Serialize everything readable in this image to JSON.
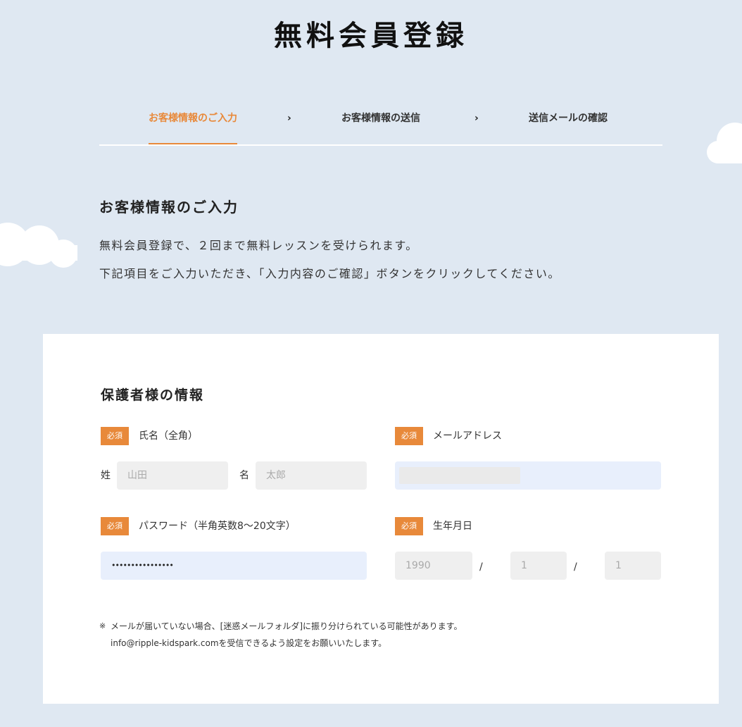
{
  "page_title": "無料会員登録",
  "steps": [
    {
      "label": "お客様情報のご入力",
      "active": true
    },
    {
      "label": "お客様情報の送信",
      "active": false
    },
    {
      "label": "送信メールの確認",
      "active": false
    }
  ],
  "chevron": "›",
  "section_heading": "お客様情報のご入力",
  "intro_lines": [
    "無料会員登録で、２回まで無料レッスンを受けられます。",
    "下記項目をご入力いただき、「入力内容のご確認」ボタンをクリックしてください。"
  ],
  "form": {
    "heading": "保護者様の情報",
    "required_badge": "必須",
    "name": {
      "label": "氏名（全角）",
      "last_label": "姓",
      "last_placeholder": "山田",
      "first_label": "名",
      "first_placeholder": "太郎"
    },
    "email": {
      "label": "メールアドレス",
      "value": ""
    },
    "password": {
      "label": "パスワード（半角英数8〜20文字）",
      "value": "••••••••••••••••"
    },
    "birthday": {
      "label": "生年月日",
      "year": "1990",
      "month": "1",
      "day": "1",
      "separator": "/"
    },
    "note_mark": "※",
    "note_lines": [
      "メールが届いていない場合、[迷惑メールフォルダ]に振り分けられている可能性があります。",
      "info@ripple-kidspark.comを受信できるよう設定をお願いいたします。"
    ]
  },
  "colors": {
    "background": "#dfe8f2",
    "accent": "#e8893a",
    "input_gray": "#efefef",
    "input_blue": "#e8effc"
  },
  "icons": [
    "chevron-right-icon",
    "cloud-icon"
  ]
}
